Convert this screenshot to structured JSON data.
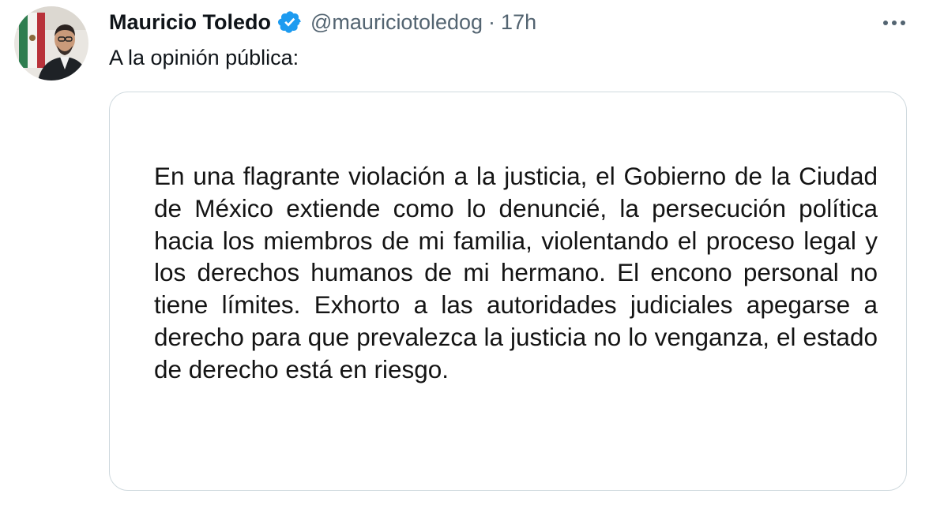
{
  "tweet": {
    "author_name": "Mauricio Toledo",
    "handle": "@mauriciotoledog",
    "separator": "·",
    "timestamp": "17h",
    "text": "A la opinión pública:",
    "verified": true
  },
  "media": {
    "statement": "En una flagrante violación a la justicia,  el Gobierno de la Ciudad de México extiende como lo denuncié, la persecución política hacia los miembros de mi familia, violentando el proceso legal y los derechos humanos de mi hermano.  El encono personal no tiene límites.  Exhorto a las autoridades judiciales apegarse a derecho para que prevalezca la justicia no lo venganza, el estado de derecho está en riesgo."
  },
  "icons": {
    "verified": "verified-badge-icon",
    "more": "more-options-icon"
  },
  "colors": {
    "text_primary": "#0f1419",
    "text_secondary": "#536471",
    "verified_blue": "#1d9bf0",
    "card_border": "#cfd9de"
  }
}
